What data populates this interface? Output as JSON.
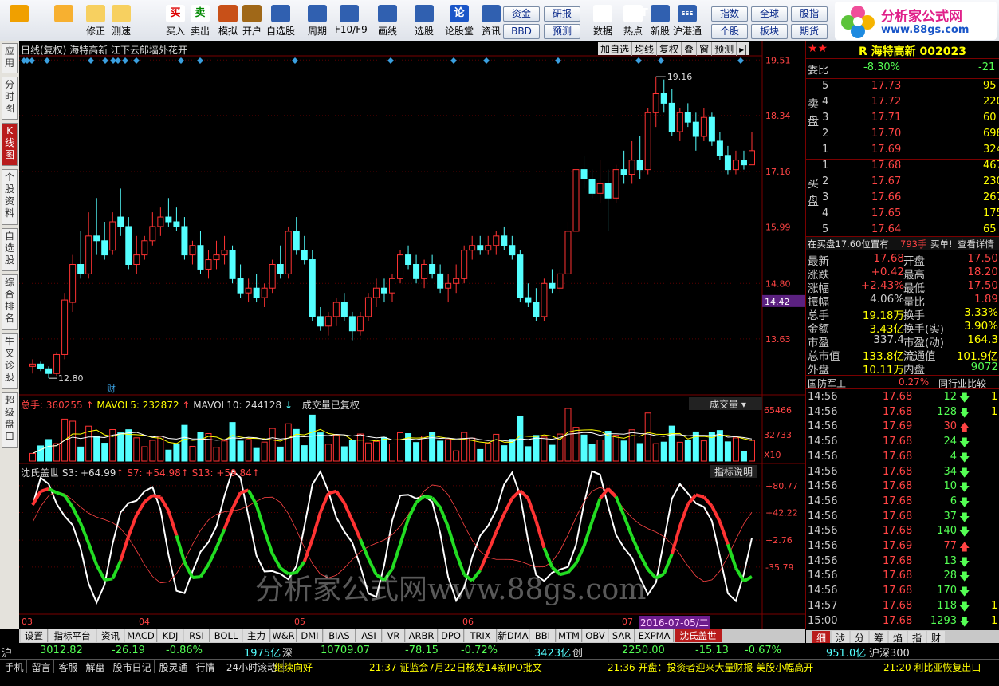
{
  "toolbar": [
    {
      "label": "",
      "icon": "home-grid-icon"
    },
    {
      "label": "",
      "icon": "back-arrow-icon"
    },
    {
      "label": "修正",
      "icon": "up-down-icon"
    },
    {
      "label": "测速",
      "icon": "speed-icon"
    },
    {
      "label": "买入",
      "icon": "buy-icon",
      "glyph": "买"
    },
    {
      "label": "卖出",
      "icon": "sell-icon",
      "glyph": "卖"
    },
    {
      "label": "模拟",
      "icon": "hammer-icon"
    },
    {
      "label": "开户",
      "icon": "lock-icon"
    },
    {
      "label": "自选股",
      "icon": "star-icon"
    },
    {
      "label": "周期",
      "icon": "clock-icon"
    },
    {
      "label": "F10/F9",
      "icon": "f10-icon"
    },
    {
      "label": "画线",
      "icon": "pen-icon"
    },
    {
      "label": "选股",
      "icon": "select-icon"
    },
    {
      "label": "论股堂",
      "icon": "talk-icon",
      "glyph": "论"
    },
    {
      "label": "资讯",
      "icon": "news-icon"
    },
    {
      "label": "数据",
      "icon": "data-icon",
      "glyph": "PE"
    },
    {
      "label": "热点",
      "icon": "hot-icon",
      "glyph": "HOT"
    },
    {
      "label": "新股",
      "icon": "newstock-icon"
    },
    {
      "label": "沪港通",
      "icon": "hk-icon",
      "glyph": "SSE HKE"
    }
  ],
  "small_buttons": [
    "资金",
    "BBD",
    "研报",
    "预测",
    "指数",
    "个股",
    "全球",
    "板块",
    "股指",
    "期货"
  ],
  "logo": {
    "title": "分析家公式网",
    "url": "www.88gs.com"
  },
  "side_tabs": [
    "应用",
    "分时图",
    "K线图",
    "个股资料",
    "自选股",
    "综合排名",
    "牛叉诊股",
    "超级盘口"
  ],
  "chart": {
    "title_left": "日线(复权)",
    "stock_name": "海特高新",
    "news": "江下云郎墙外花开",
    "right_buttons": [
      "加自选",
      "均线",
      "复权",
      "叠",
      "窗",
      "预测"
    ],
    "price_levels": [
      "19.51",
      "18.34",
      "17.16",
      "15.99",
      "14.80",
      "13.63"
    ],
    "current_price_tag": "14.42",
    "high_label": "19.16",
    "low_label": "12.80",
    "cai_label": "财",
    "volume": {
      "total_label": "总手: 360255",
      "mavol5": "MAVOL5: 232872",
      "mavol10": "MAVOL10: 244128",
      "note": "成交量已复权",
      "selector": "成交量",
      "levels": [
        "65466",
        "32733",
        "X10"
      ]
    },
    "indicator": {
      "name": "沈氏盖世",
      "s3": "S3: +64.99",
      "s7": "S7: +54.98",
      "s13": "S13: +59.84",
      "help": "指标说明",
      "levels": [
        "+80.77",
        "+42.22",
        "+2.76",
        "-35.79"
      ]
    },
    "x_months": [
      "03",
      "04",
      "05",
      "06",
      "07"
    ],
    "date_tag": "2016-07-05/二",
    "watermark": "分析家公式网www.88gs.com"
  },
  "chart_data": {
    "type": "candlestick",
    "title": "海特高新 日线(复权)",
    "ylim": [
      12.5,
      19.7
    ],
    "bars": [
      [
        13.05,
        13.2,
        12.9,
        13.1
      ],
      [
        13.1,
        13.15,
        12.95,
        13.0
      ],
      [
        13.0,
        13.05,
        12.8,
        12.9
      ],
      [
        12.9,
        13.35,
        12.85,
        13.3
      ],
      [
        13.3,
        14.6,
        13.2,
        14.45
      ],
      [
        14.4,
        15.4,
        14.2,
        15.2
      ],
      [
        15.2,
        15.9,
        14.9,
        15.0
      ],
      [
        15.0,
        16.3,
        14.9,
        15.8
      ],
      [
        15.8,
        16.6,
        15.4,
        15.7
      ],
      [
        15.7,
        16.1,
        15.3,
        15.4
      ],
      [
        15.5,
        16.3,
        15.4,
        16.1
      ],
      [
        16.2,
        16.8,
        15.8,
        16.0
      ],
      [
        16.0,
        16.2,
        15.1,
        15.2
      ],
      [
        15.2,
        15.8,
        15.0,
        15.4
      ],
      [
        15.4,
        15.8,
        15.3,
        15.7
      ],
      [
        15.7,
        16.3,
        15.6,
        16.0
      ],
      [
        16.0,
        16.4,
        15.8,
        16.2
      ],
      [
        16.2,
        16.6,
        16.0,
        16.1
      ],
      [
        16.1,
        16.4,
        15.9,
        16.0
      ],
      [
        16.0,
        16.2,
        15.3,
        15.4
      ],
      [
        15.4,
        15.7,
        15.2,
        15.6
      ],
      [
        15.6,
        15.9,
        15.0,
        15.1
      ],
      [
        15.1,
        15.5,
        14.9,
        15.3
      ],
      [
        15.3,
        15.7,
        15.1,
        15.4
      ],
      [
        15.4,
        15.8,
        15.2,
        15.5
      ],
      [
        15.5,
        15.6,
        14.8,
        14.9
      ],
      [
        14.9,
        15.2,
        14.5,
        14.6
      ],
      [
        14.6,
        14.9,
        14.4,
        14.7
      ],
      [
        14.7,
        15.0,
        14.4,
        14.5
      ],
      [
        14.5,
        14.8,
        14.3,
        14.7
      ],
      [
        14.7,
        15.3,
        14.6,
        15.2
      ],
      [
        15.2,
        15.6,
        14.9,
        15.0
      ],
      [
        15.0,
        16.0,
        14.9,
        15.9
      ],
      [
        15.9,
        16.2,
        15.4,
        15.5
      ],
      [
        15.5,
        15.8,
        15.2,
        15.3
      ],
      [
        15.3,
        15.5,
        14.0,
        14.1
      ],
      [
        14.1,
        14.3,
        13.8,
        13.9
      ],
      [
        13.9,
        14.2,
        13.7,
        14.1
      ],
      [
        14.1,
        14.5,
        13.9,
        14.4
      ],
      [
        14.4,
        14.6,
        14.0,
        14.1
      ],
      [
        14.1,
        14.2,
        13.6,
        13.8
      ],
      [
        13.8,
        14.2,
        13.7,
        14.1
      ],
      [
        14.1,
        14.6,
        14.0,
        14.5
      ],
      [
        14.5,
        14.9,
        14.3,
        14.7
      ],
      [
        14.7,
        14.9,
        14.4,
        14.6
      ],
      [
        14.6,
        15.0,
        14.4,
        14.9
      ],
      [
        14.9,
        15.5,
        14.8,
        15.4
      ],
      [
        15.4,
        15.6,
        15.1,
        15.2
      ],
      [
        15.2,
        15.4,
        14.8,
        14.9
      ],
      [
        14.9,
        15.3,
        14.7,
        15.2
      ],
      [
        15.2,
        15.4,
        14.9,
        15.0
      ],
      [
        15.0,
        15.2,
        14.6,
        14.7
      ],
      [
        14.7,
        15.0,
        14.4,
        14.8
      ],
      [
        14.8,
        15.2,
        14.6,
        14.9
      ],
      [
        14.9,
        15.6,
        14.8,
        15.5
      ],
      [
        15.5,
        15.8,
        15.3,
        15.6
      ],
      [
        15.6,
        15.8,
        15.4,
        15.5
      ],
      [
        15.5,
        15.8,
        15.4,
        15.6
      ],
      [
        15.6,
        15.9,
        15.4,
        15.8
      ],
      [
        15.8,
        16.0,
        15.5,
        15.6
      ],
      [
        15.6,
        15.8,
        15.3,
        15.4
      ],
      [
        15.4,
        15.5,
        14.4,
        14.5
      ],
      [
        14.5,
        14.8,
        14.3,
        14.4
      ],
      [
        14.4,
        14.7,
        14.0,
        14.1
      ],
      [
        14.1,
        14.9,
        14.0,
        14.8
      ],
      [
        14.8,
        15.1,
        14.6,
        14.7
      ],
      [
        14.7,
        15.1,
        14.6,
        15.0
      ],
      [
        15.0,
        16.1,
        14.9,
        15.9
      ],
      [
        15.9,
        17.3,
        15.8,
        17.2
      ],
      [
        17.2,
        17.5,
        16.8,
        17.0
      ],
      [
        17.0,
        17.2,
        16.6,
        16.7
      ],
      [
        16.7,
        17.4,
        16.5,
        16.9
      ],
      [
        16.9,
        17.2,
        15.9,
        16.6
      ],
      [
        16.6,
        17.3,
        16.5,
        17.2
      ],
      [
        17.2,
        17.6,
        16.9,
        17.1
      ],
      [
        17.1,
        17.8,
        16.9,
        17.4
      ],
      [
        17.4,
        17.9,
        17.0,
        17.2
      ],
      [
        17.2,
        18.5,
        17.1,
        18.4
      ],
      [
        18.4,
        19.16,
        18.1,
        18.8
      ],
      [
        18.8,
        19.1,
        18.4,
        18.6
      ],
      [
        18.6,
        18.9,
        17.9,
        18.0
      ],
      [
        18.0,
        18.5,
        17.8,
        18.4
      ],
      [
        18.4,
        18.6,
        18.1,
        18.2
      ],
      [
        18.2,
        18.4,
        17.6,
        17.9
      ],
      [
        17.9,
        18.5,
        17.8,
        18.3
      ],
      [
        18.3,
        18.4,
        17.7,
        17.8
      ],
      [
        17.8,
        18.0,
        17.4,
        17.5
      ],
      [
        17.5,
        17.7,
        17.1,
        17.2
      ],
      [
        17.2,
        17.6,
        17.1,
        17.4
      ],
      [
        17.4,
        17.6,
        17.2,
        17.3
      ],
      [
        17.3,
        18.0,
        17.3,
        17.6
      ]
    ],
    "volume_max": 65466
  },
  "right_panel": {
    "code": "R 海特高新 002023",
    "weibi_label": "委比",
    "weibi": "-8.30%",
    "weicha": "-21",
    "sell_label": "卖盘",
    "buy_label": "买盘",
    "asks": [
      [
        "5",
        "17.73",
        "95"
      ],
      [
        "4",
        "17.72",
        "220"
      ],
      [
        "3",
        "17.71",
        "60"
      ],
      [
        "2",
        "17.70",
        "698"
      ],
      [
        "1",
        "17.69",
        "324"
      ]
    ],
    "bids": [
      [
        "1",
        "17.68",
        "467"
      ],
      [
        "2",
        "17.67",
        "230"
      ],
      [
        "3",
        "17.66",
        "267"
      ],
      [
        "4",
        "17.65",
        "175"
      ],
      [
        "5",
        "17.64",
        "65"
      ]
    ],
    "msg1": "在买盘17.60位置有",
    "msg2": "793手",
    "msg3": "买单!",
    "msg4": "查看详情",
    "quote": [
      [
        "最新",
        "17.68",
        "开盘",
        "17.50"
      ],
      [
        "涨跌",
        "+0.42",
        "最高",
        "18.20"
      ],
      [
        "涨幅",
        "+2.43%",
        "最低",
        "17.50"
      ],
      [
        "振幅",
        "4.06%",
        "量比",
        "1.89"
      ],
      [
        "总手",
        "19.18万",
        "换手",
        "3.33%"
      ],
      [
        "金额",
        "3.43亿",
        "换手(实)",
        "3.90%"
      ],
      [
        "市盈",
        "337.4",
        "市盈(动)",
        "164.3"
      ],
      [
        "总市值",
        "133.8亿",
        "流通值",
        "101.9亿"
      ],
      [
        "外盘",
        "10.11万",
        "内盘",
        "9072"
      ]
    ],
    "industry": "国防军工",
    "industry_change": "0.27%",
    "industry_btn": "同行业比较",
    "ticks": [
      [
        "14:56",
        "17.68",
        "12",
        "down",
        "1"
      ],
      [
        "14:56",
        "17.68",
        "128",
        "down",
        "1"
      ],
      [
        "14:56",
        "17.69",
        "30",
        "up",
        ""
      ],
      [
        "14:56",
        "17.68",
        "24",
        "down",
        ""
      ],
      [
        "14:56",
        "17.68",
        "4",
        "down",
        ""
      ],
      [
        "14:56",
        "17.68",
        "34",
        "down",
        ""
      ],
      [
        "14:56",
        "17.68",
        "10",
        "down",
        ""
      ],
      [
        "14:56",
        "17.68",
        "6",
        "down",
        ""
      ],
      [
        "14:56",
        "17.68",
        "37",
        "down",
        ""
      ],
      [
        "14:56",
        "17.68",
        "140",
        "down",
        ""
      ],
      [
        "14:56",
        "17.69",
        "77",
        "up",
        ""
      ],
      [
        "14:56",
        "17.68",
        "13",
        "down",
        ""
      ],
      [
        "14:56",
        "17.68",
        "28",
        "down",
        ""
      ],
      [
        "14:56",
        "17.68",
        "170",
        "down",
        ""
      ],
      [
        "14:57",
        "17.68",
        "118",
        "down",
        "1"
      ],
      [
        "15:00",
        "17.68",
        "1293",
        "down",
        "1"
      ]
    ],
    "tabs": [
      "细",
      "涉",
      "分",
      "筹",
      "焰",
      "指",
      "财"
    ]
  },
  "bottom_tabs": [
    "设置",
    "指标平台",
    "资讯",
    "MACD",
    "KDJ",
    "RSI",
    "BOLL",
    "主力",
    "W&R",
    "DMI",
    "BIAS",
    "ASI",
    "VR",
    "ARBR",
    "DPO",
    "TRIX",
    "新DMA",
    "BBI",
    "MTM",
    "OBV",
    "SAR",
    "EXPMA",
    "沈氏盖世"
  ],
  "statusbar": {
    "sh_label": "沪",
    "sh_val": "3012.82",
    "sh_chg": "-26.19",
    "sh_pct": "-0.86%",
    "sh_amt": "1975亿",
    "sz_label": "深",
    "sz_val": "10709.07",
    "sz_chg": "-78.15",
    "sz_pct": "-0.72%",
    "sz_amt": "3423亿",
    "cy_label": "创",
    "cy_val": "2250.00",
    "cy_chg": "-15.13",
    "cy_pct": "-0.67%",
    "cy_amt": "951.0亿",
    "hs_label": "沪深300"
  },
  "footer": {
    "buttons": [
      "手机",
      "留言",
      "客服",
      "解盘",
      "股市日记",
      "股灵通",
      "行情",
      "24小时滚动"
    ],
    "news1": "继续向好",
    "news2": "21:37 证监会7月22日核发14家IPO批文",
    "news3": "21:36 开盘：投资者迎来大量财报 美股小幅高开",
    "news4": "21:20 利比亚恢复出口"
  },
  "colors": {
    "up": "#ff3333",
    "down": "#54ffff",
    "grid": "#7a0000",
    "yellow": "#ffff00"
  }
}
